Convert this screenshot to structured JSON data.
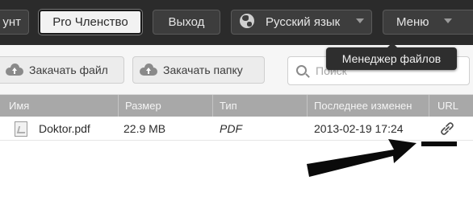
{
  "topbar": {
    "account_label": "унт",
    "pro_label": "Pro Членство",
    "exit_label": "Выход",
    "language_label": "Русский язык",
    "menu_label": "Меню"
  },
  "tooltip": {
    "text": "Менеджер файлов"
  },
  "toolbar": {
    "upload_file_label": "Закачать файл",
    "upload_folder_label": "Закачать папку"
  },
  "search": {
    "placeholder": "Поиск"
  },
  "table": {
    "columns": [
      "Имя",
      "Размер",
      "Тип",
      "Последнее изменен",
      "URL"
    ],
    "rows": [
      {
        "name": "Doktor.pdf",
        "size": "22.9 MB",
        "type": "PDF",
        "modified": "2013-02-19 17:24",
        "url_icon": "link-icon"
      }
    ]
  },
  "colors": {
    "topbar_bg": "#2b2b2b",
    "header_bg": "#a8a8a8",
    "toolbar_bg": "#f6f6f6"
  }
}
